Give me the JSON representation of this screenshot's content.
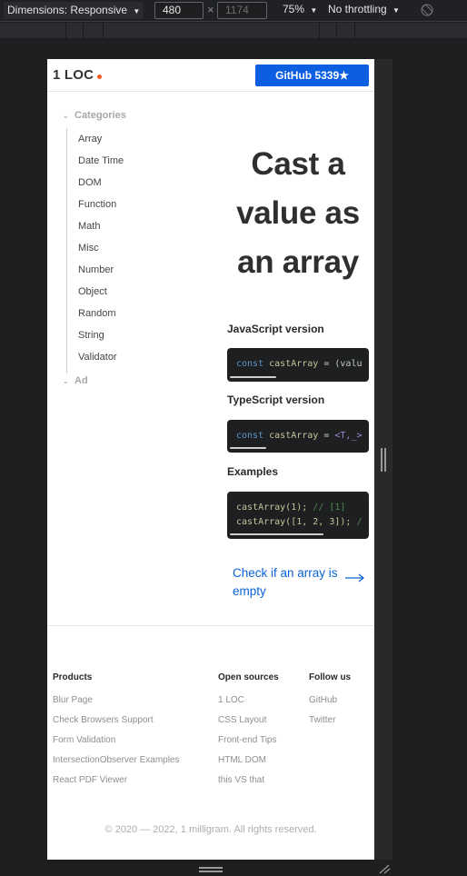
{
  "devtools": {
    "dimensions_label": "Dimensions: Responsive",
    "width_value": "480",
    "height_placeholder": "1174",
    "times_sign": "×",
    "zoom_label": "75%",
    "throttling_label": "No throttling",
    "dropdown_caret": "▼"
  },
  "site": {
    "logo": "1 LOC",
    "github_button": "GitHub 5339★",
    "accent_color": "#f45b1e",
    "link_color": "#0b62d6"
  },
  "sidebar": {
    "categories_label": "Categories",
    "items": [
      "Array",
      "Date Time",
      "DOM",
      "Function",
      "Math",
      "Misc",
      "Number",
      "Object",
      "Random",
      "String",
      "Validator"
    ],
    "ad_label": "Ad",
    "chevron": "⌄"
  },
  "main": {
    "title_lines": [
      "Cast a",
      "value as",
      "an array"
    ],
    "js_heading": "JavaScript version",
    "js_code": {
      "kw": "const",
      "name": "castArray",
      "rest": " = (valu"
    },
    "ts_heading": "TypeScript version",
    "ts_code": {
      "kw": "const",
      "name": "castArray",
      "eq": " = ",
      "generic": "<T,_>"
    },
    "examples_heading": "Examples",
    "examples": [
      {
        "code": "castArray(1); ",
        "comment": "// [1]"
      },
      {
        "code": "castArray([1, 2, 3]); ",
        "comment": "/"
      }
    ],
    "next_link": "Check if an array is empty"
  },
  "footer": {
    "columns": [
      {
        "heading": "Products",
        "links": [
          "Blur Page",
          "Check Browsers Support",
          "Form Validation",
          "IntersectionObserver Examples",
          "React PDF Viewer"
        ]
      },
      {
        "heading": "Open sources",
        "links": [
          "1 LOC",
          "CSS Layout",
          "Front-end Tips",
          "HTML DOM",
          "this VS that"
        ]
      },
      {
        "heading": "Follow us",
        "links": [
          "GitHub",
          "Twitter"
        ]
      }
    ],
    "copyright": "© 2020 — 2022, 1 milligram. All rights reserved."
  }
}
